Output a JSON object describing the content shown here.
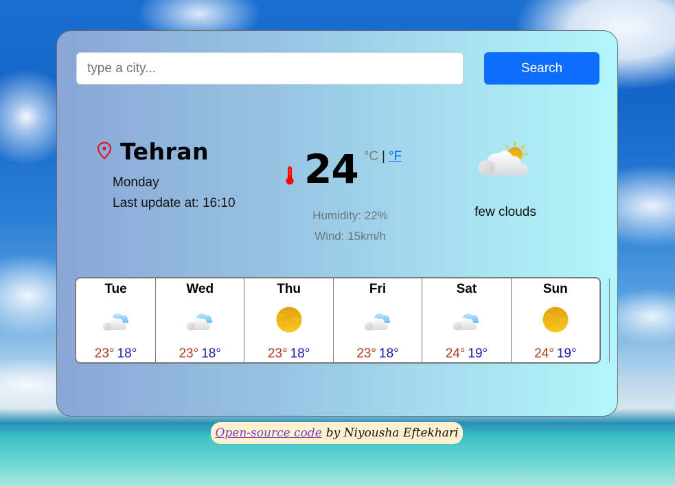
{
  "search": {
    "placeholder": "type a city...",
    "value": "",
    "button_label": "Search"
  },
  "current": {
    "city": "Tehran",
    "day": "Monday",
    "last_update": "Last update at: 16:10",
    "temperature": "24",
    "unit_c": "°C",
    "unit_separator": "|",
    "unit_f": "°F",
    "humidity": "Humidity: 22%",
    "wind": "Wind: 15km/h",
    "condition": "few clouds",
    "condition_icon": "few-clouds-icon",
    "location_icon": "map-pin-icon",
    "temp_icon": "thermometer-icon"
  },
  "forecast": [
    {
      "day": "Tue",
      "icon": "cloud-icon",
      "max": "23°",
      "min": "18°"
    },
    {
      "day": "Wed",
      "icon": "cloud-icon",
      "max": "23°",
      "min": "18°"
    },
    {
      "day": "Thu",
      "icon": "sun-icon",
      "max": "23°",
      "min": "18°"
    },
    {
      "day": "Fri",
      "icon": "cloud-icon",
      "max": "23°",
      "min": "18°"
    },
    {
      "day": "Sat",
      "icon": "cloud-icon",
      "max": "24°",
      "min": "19°"
    },
    {
      "day": "Sun",
      "icon": "sun-icon",
      "max": "24°",
      "min": "19°"
    }
  ],
  "footer": {
    "link_label": "Open-source code",
    "text": "by Niyousha Eftekhari"
  },
  "colors": {
    "accent": "#0d6efd",
    "max_temp": "#b23a1e",
    "min_temp": "#1a1aa0",
    "pin": "#e8141c"
  }
}
